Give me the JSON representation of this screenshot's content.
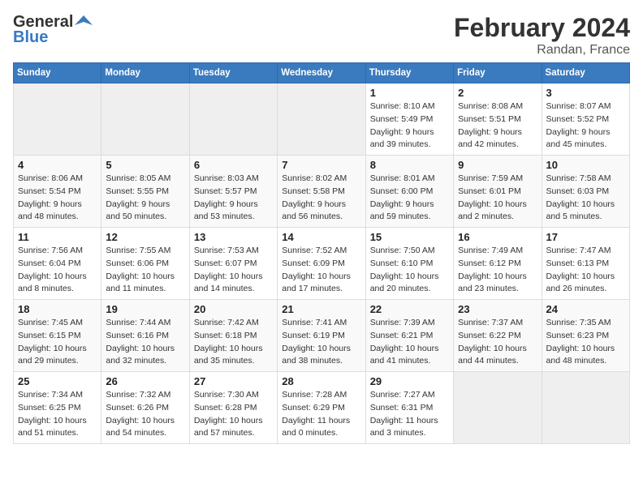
{
  "header": {
    "logo_general": "General",
    "logo_blue": "Blue",
    "title": "February 2024",
    "subtitle": "Randan, France"
  },
  "weekdays": [
    "Sunday",
    "Monday",
    "Tuesday",
    "Wednesday",
    "Thursday",
    "Friday",
    "Saturday"
  ],
  "weeks": [
    [
      {
        "day": "",
        "info": ""
      },
      {
        "day": "",
        "info": ""
      },
      {
        "day": "",
        "info": ""
      },
      {
        "day": "",
        "info": ""
      },
      {
        "day": "1",
        "info": "Sunrise: 8:10 AM\nSunset: 5:49 PM\nDaylight: 9 hours\nand 39 minutes."
      },
      {
        "day": "2",
        "info": "Sunrise: 8:08 AM\nSunset: 5:51 PM\nDaylight: 9 hours\nand 42 minutes."
      },
      {
        "day": "3",
        "info": "Sunrise: 8:07 AM\nSunset: 5:52 PM\nDaylight: 9 hours\nand 45 minutes."
      }
    ],
    [
      {
        "day": "4",
        "info": "Sunrise: 8:06 AM\nSunset: 5:54 PM\nDaylight: 9 hours\nand 48 minutes."
      },
      {
        "day": "5",
        "info": "Sunrise: 8:05 AM\nSunset: 5:55 PM\nDaylight: 9 hours\nand 50 minutes."
      },
      {
        "day": "6",
        "info": "Sunrise: 8:03 AM\nSunset: 5:57 PM\nDaylight: 9 hours\nand 53 minutes."
      },
      {
        "day": "7",
        "info": "Sunrise: 8:02 AM\nSunset: 5:58 PM\nDaylight: 9 hours\nand 56 minutes."
      },
      {
        "day": "8",
        "info": "Sunrise: 8:01 AM\nSunset: 6:00 PM\nDaylight: 9 hours\nand 59 minutes."
      },
      {
        "day": "9",
        "info": "Sunrise: 7:59 AM\nSunset: 6:01 PM\nDaylight: 10 hours\nand 2 minutes."
      },
      {
        "day": "10",
        "info": "Sunrise: 7:58 AM\nSunset: 6:03 PM\nDaylight: 10 hours\nand 5 minutes."
      }
    ],
    [
      {
        "day": "11",
        "info": "Sunrise: 7:56 AM\nSunset: 6:04 PM\nDaylight: 10 hours\nand 8 minutes."
      },
      {
        "day": "12",
        "info": "Sunrise: 7:55 AM\nSunset: 6:06 PM\nDaylight: 10 hours\nand 11 minutes."
      },
      {
        "day": "13",
        "info": "Sunrise: 7:53 AM\nSunset: 6:07 PM\nDaylight: 10 hours\nand 14 minutes."
      },
      {
        "day": "14",
        "info": "Sunrise: 7:52 AM\nSunset: 6:09 PM\nDaylight: 10 hours\nand 17 minutes."
      },
      {
        "day": "15",
        "info": "Sunrise: 7:50 AM\nSunset: 6:10 PM\nDaylight: 10 hours\nand 20 minutes."
      },
      {
        "day": "16",
        "info": "Sunrise: 7:49 AM\nSunset: 6:12 PM\nDaylight: 10 hours\nand 23 minutes."
      },
      {
        "day": "17",
        "info": "Sunrise: 7:47 AM\nSunset: 6:13 PM\nDaylight: 10 hours\nand 26 minutes."
      }
    ],
    [
      {
        "day": "18",
        "info": "Sunrise: 7:45 AM\nSunset: 6:15 PM\nDaylight: 10 hours\nand 29 minutes."
      },
      {
        "day": "19",
        "info": "Sunrise: 7:44 AM\nSunset: 6:16 PM\nDaylight: 10 hours\nand 32 minutes."
      },
      {
        "day": "20",
        "info": "Sunrise: 7:42 AM\nSunset: 6:18 PM\nDaylight: 10 hours\nand 35 minutes."
      },
      {
        "day": "21",
        "info": "Sunrise: 7:41 AM\nSunset: 6:19 PM\nDaylight: 10 hours\nand 38 minutes."
      },
      {
        "day": "22",
        "info": "Sunrise: 7:39 AM\nSunset: 6:21 PM\nDaylight: 10 hours\nand 41 minutes."
      },
      {
        "day": "23",
        "info": "Sunrise: 7:37 AM\nSunset: 6:22 PM\nDaylight: 10 hours\nand 44 minutes."
      },
      {
        "day": "24",
        "info": "Sunrise: 7:35 AM\nSunset: 6:23 PM\nDaylight: 10 hours\nand 48 minutes."
      }
    ],
    [
      {
        "day": "25",
        "info": "Sunrise: 7:34 AM\nSunset: 6:25 PM\nDaylight: 10 hours\nand 51 minutes."
      },
      {
        "day": "26",
        "info": "Sunrise: 7:32 AM\nSunset: 6:26 PM\nDaylight: 10 hours\nand 54 minutes."
      },
      {
        "day": "27",
        "info": "Sunrise: 7:30 AM\nSunset: 6:28 PM\nDaylight: 10 hours\nand 57 minutes."
      },
      {
        "day": "28",
        "info": "Sunrise: 7:28 AM\nSunset: 6:29 PM\nDaylight: 11 hours\nand 0 minutes."
      },
      {
        "day": "29",
        "info": "Sunrise: 7:27 AM\nSunset: 6:31 PM\nDaylight: 11 hours\nand 3 minutes."
      },
      {
        "day": "",
        "info": ""
      },
      {
        "day": "",
        "info": ""
      }
    ]
  ]
}
